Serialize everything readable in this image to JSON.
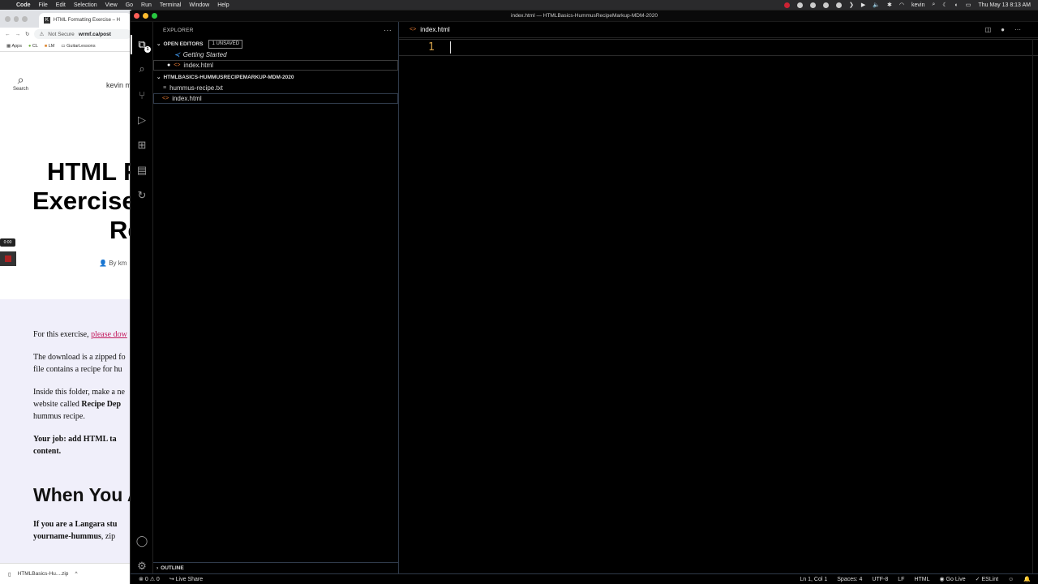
{
  "menubar": {
    "app": "Code",
    "items": [
      "File",
      "Edit",
      "Selection",
      "View",
      "Go",
      "Run",
      "Terminal",
      "Window",
      "Help"
    ],
    "user": "kevin",
    "datetime": "Thu May 13  8:13 AM"
  },
  "browser": {
    "tab_title": "HTML Formatting Exercise – H",
    "tab_favicon": "K",
    "url_security": "Not Secure",
    "url": "wrmf.ca/post",
    "bookmarks": [
      "Apps",
      "CL",
      "LM",
      "GuitarLessons"
    ],
    "search_label": "Search",
    "author_top": "kevin m",
    "title_lines": [
      "HTML F",
      "Exercise",
      "Re"
    ],
    "byline": "By km",
    "timer": "0:00",
    "para1_text": "For this exercise, ",
    "para1_link": "please dow",
    "para2_line1": "The download is a zipped fo",
    "para2_line2": "file contains a recipe for hu",
    "para3_line1": "Inside this folder, make a ne",
    "para3_line2a": "website called ",
    "para3_line2b": "Recipe Dep",
    "para3_line3": "hummus recipe.",
    "para4_line1": "Your job: add HTML ta",
    "para4_line2": "content.",
    "heading2": "When You A",
    "para5_line1": "If you are a Langara stu",
    "para5_line2a": "yourname-hummus",
    "para5_line2b": ", zip",
    "download_file": "HTMLBasics-Hu....zip"
  },
  "vscode": {
    "window_title": "index.html — HTMLBasics-HummusRecipeMarkup-MDM-2020",
    "explorer_title": "EXPLORER",
    "open_editors": "OPEN EDITORS",
    "unsaved_badge": "1 UNSAVED",
    "open_editor_items": [
      "Getting Started",
      "index.html"
    ],
    "folder_name": "HTMLBASICS-HUMMUSRECIPEMARKUP-MDM-2020",
    "files": [
      "hummus-recipe.txt",
      "index.html"
    ],
    "outline": "OUTLINE",
    "editor_tab": "index.html",
    "line_number": "1",
    "explorer_badge": "1",
    "status": {
      "errors": "0",
      "warnings": "0",
      "live_share": "Live Share",
      "position": "Ln 1, Col 1",
      "spaces": "Spaces: 4",
      "encoding": "UTF-8",
      "eol": "LF",
      "language": "HTML",
      "go_live": "Go Live",
      "eslint": "ESLint"
    }
  }
}
